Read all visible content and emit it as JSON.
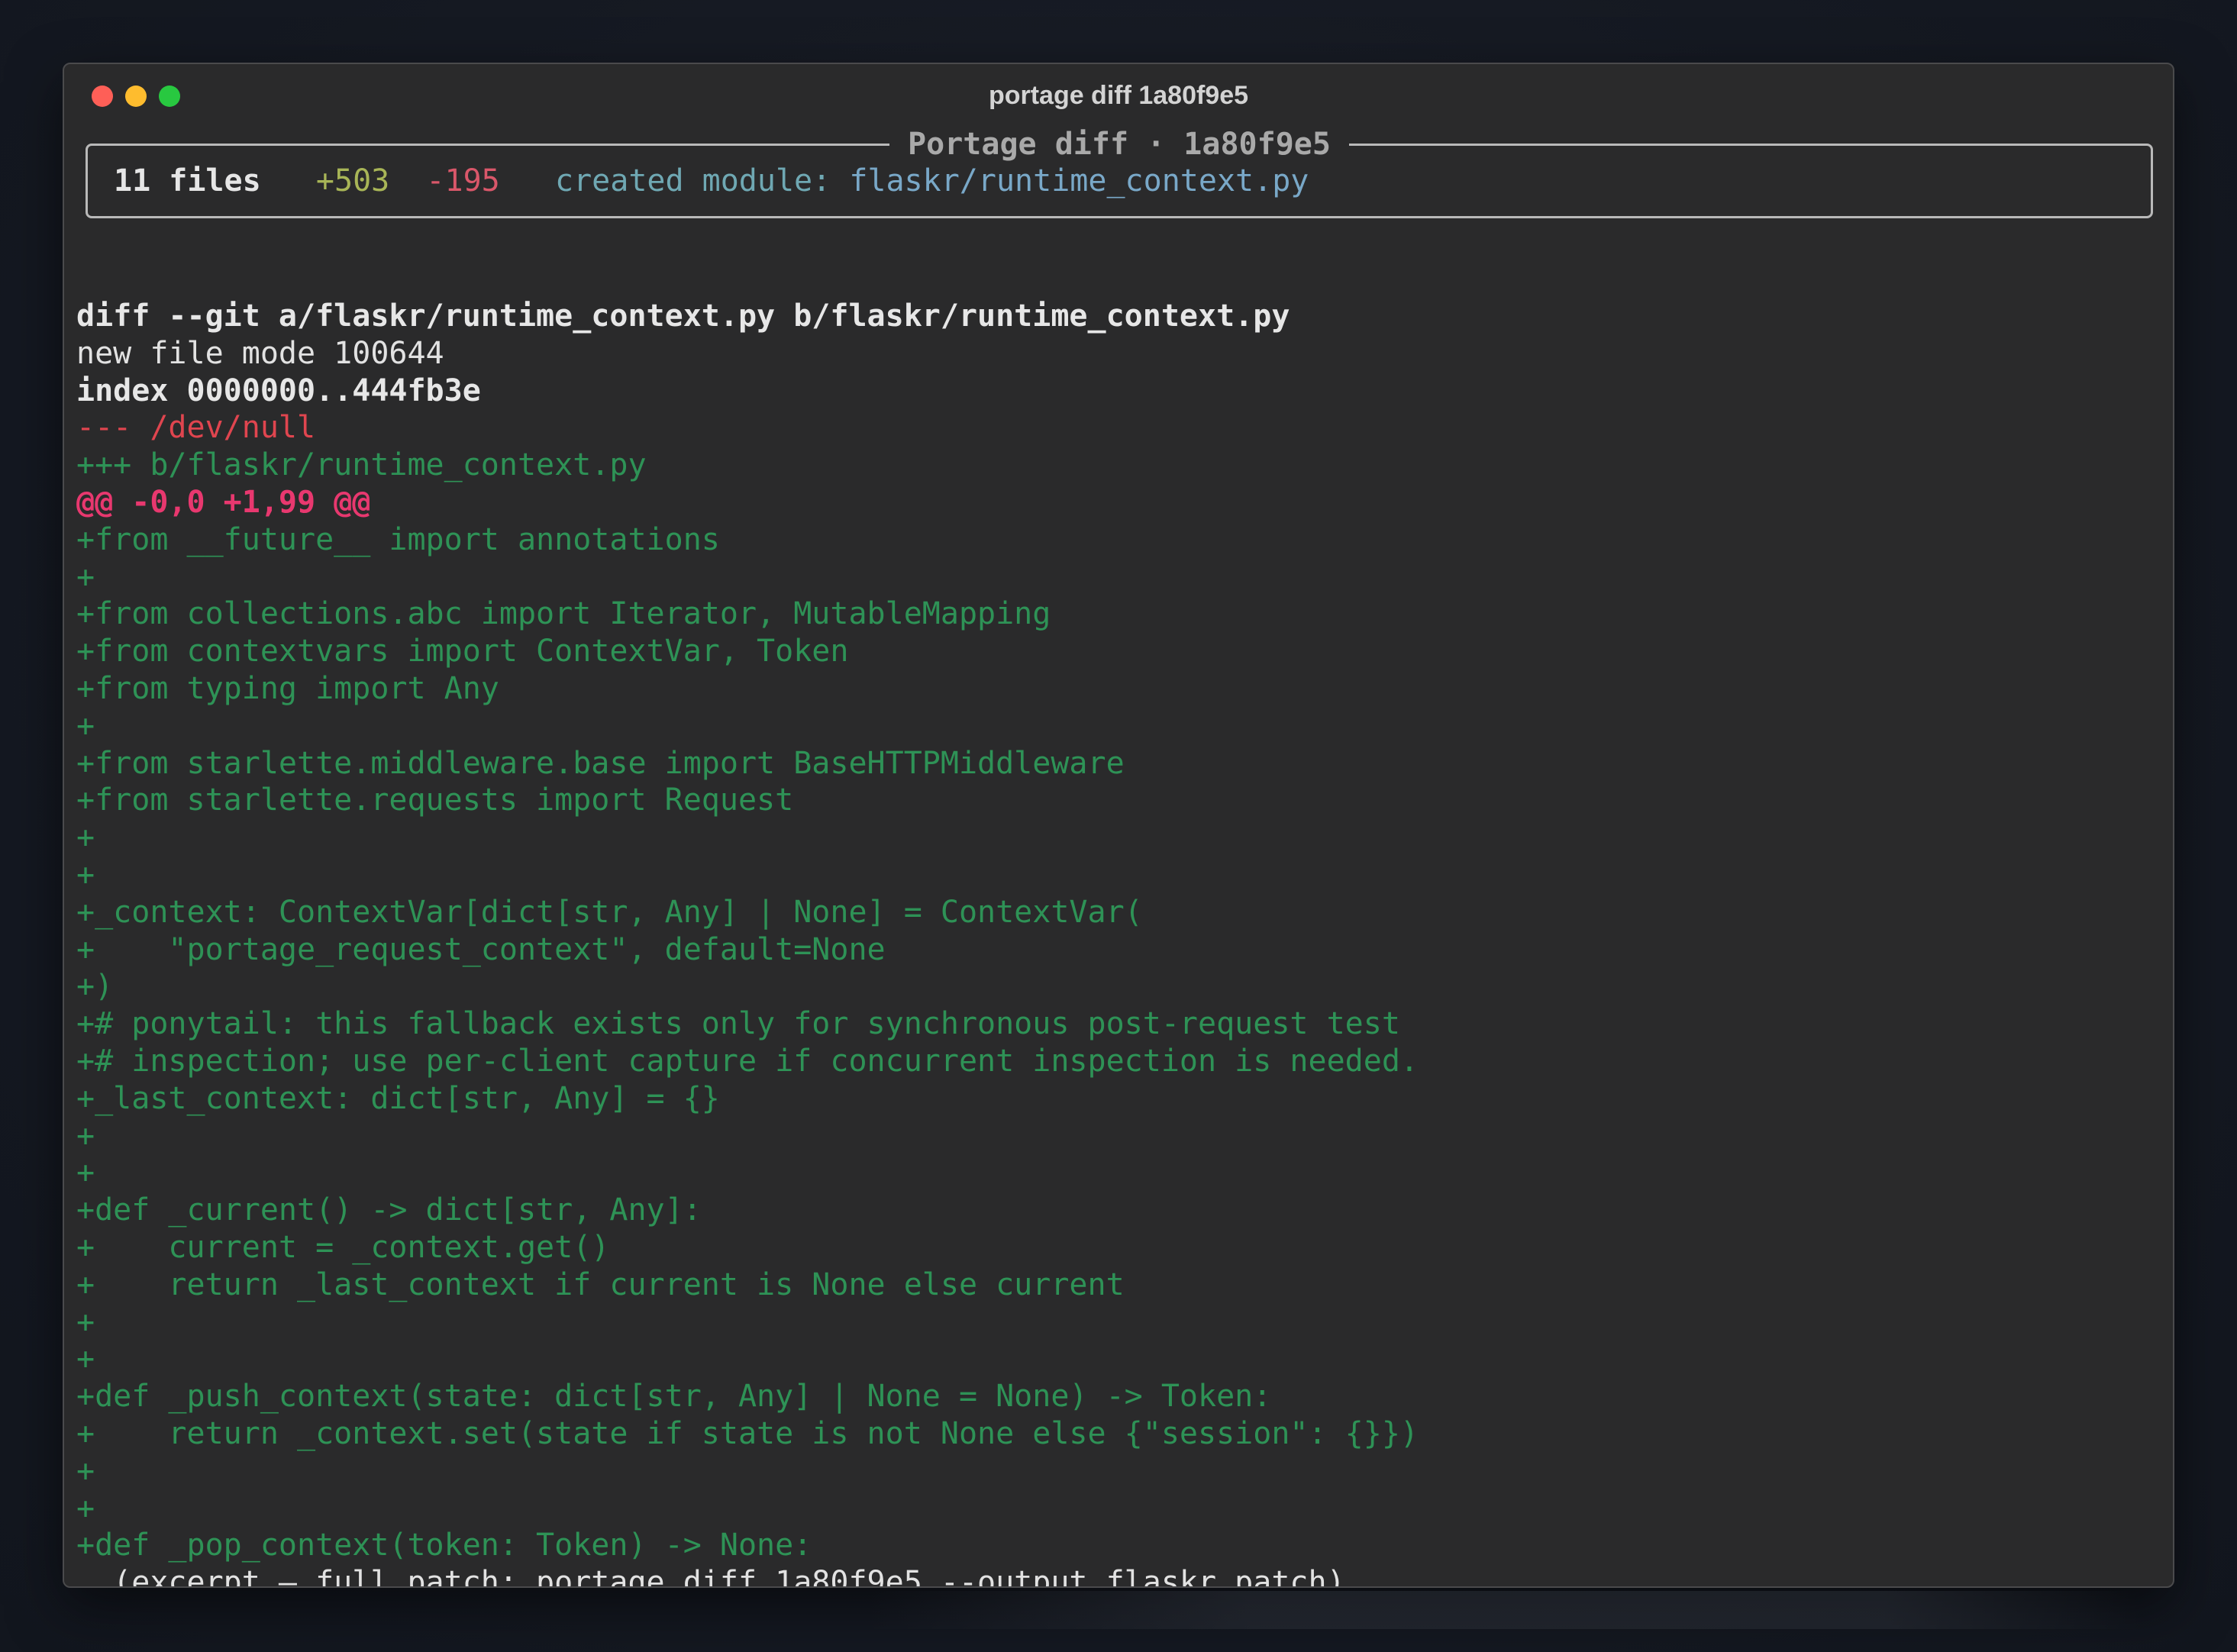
{
  "window": {
    "title": "portage diff 1a80f9e5"
  },
  "header": {
    "legend": "Portage diff · 1a80f9e5",
    "files": "11 files",
    "additions": "+503",
    "deletions": "-195",
    "created_label": "created module:",
    "created_path": "flaskr/runtime_context.py"
  },
  "diff": {
    "git_line": "diff --git a/flaskr/runtime_context.py b/flaskr/runtime_context.py",
    "mode_line": "new file mode 100644",
    "index_line": "index 0000000..444fb3e",
    "minus_file": "--- /dev/null",
    "plus_file": "+++ b/flaskr/runtime_context.py",
    "hunk": "@@ -0,0 +1,99 @@",
    "lines": [
      "+from __future__ import annotations",
      "+",
      "+from collections.abc import Iterator, MutableMapping",
      "+from contextvars import ContextVar, Token",
      "+from typing import Any",
      "+",
      "+from starlette.middleware.base import BaseHTTPMiddleware",
      "+from starlette.requests import Request",
      "+",
      "+",
      "+_context: ContextVar[dict[str, Any] | None] = ContextVar(",
      "+    \"portage_request_context\", default=None",
      "+)",
      "+# ponytail: this fallback exists only for synchronous post-request test",
      "+# inspection; use per-client capture if concurrent inspection is needed.",
      "+_last_context: dict[str, Any] = {}",
      "+",
      "+",
      "+def _current() -> dict[str, Any]:",
      "+    current = _context.get()",
      "+    return _last_context if current is None else current",
      "+",
      "+",
      "+def _push_context(state: dict[str, Any] | None = None) -> Token:",
      "+    return _context.set(state if state is not None else {\"session\": {}})",
      "+",
      "+",
      "+def _pop_context(token: Token) -> None:"
    ],
    "excerpt": "… (excerpt — full patch: portage diff 1a80f9e5 --output flaskr.patch)"
  }
}
